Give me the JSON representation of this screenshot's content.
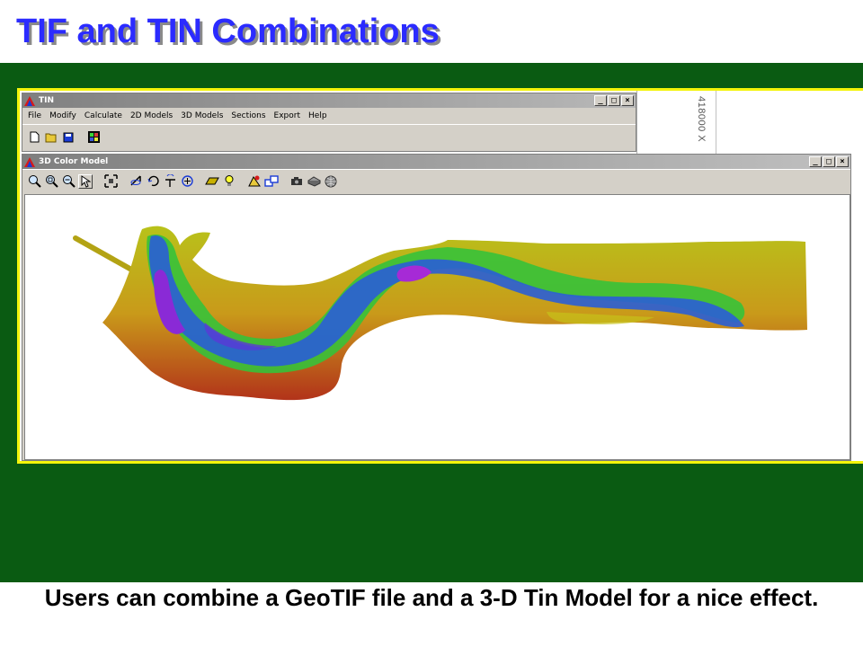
{
  "slide": {
    "title": "TIF and TIN Combinations",
    "caption": "Users can combine a GeoTIF file and a 3-D Tin Model for a nice effect."
  },
  "colors": {
    "title": "#2b2bff",
    "panel": "#0a5b12",
    "frame": "#f4f40a"
  },
  "tin_window": {
    "title": "TIN",
    "menu": [
      "File",
      "Modify",
      "Calculate",
      "2D Models",
      "3D Models",
      "Sections",
      "Export",
      "Help"
    ],
    "toolbar_icons": [
      "new-file-icon",
      "open-folder-icon",
      "save-icon",
      "grid-icon"
    ],
    "controls": [
      "minimize-icon",
      "maximize-icon",
      "close-icon"
    ]
  },
  "side_panel": {
    "coordinate_label": "418000 X"
  },
  "model_window": {
    "title": "3D Color Model",
    "toolbar_icons": [
      "zoom-in-icon",
      "zoom-window-icon",
      "zoom-out-icon",
      "pointer-icon",
      "zoom-extents-icon",
      "rotate-icon",
      "rotate-axis-icon",
      "tilt-icon",
      "pan-icon",
      "shade-icon",
      "light-icon",
      "render-icon",
      "window-copy-icon",
      "camera-icon",
      "print-icon",
      "globe-icon"
    ]
  }
}
